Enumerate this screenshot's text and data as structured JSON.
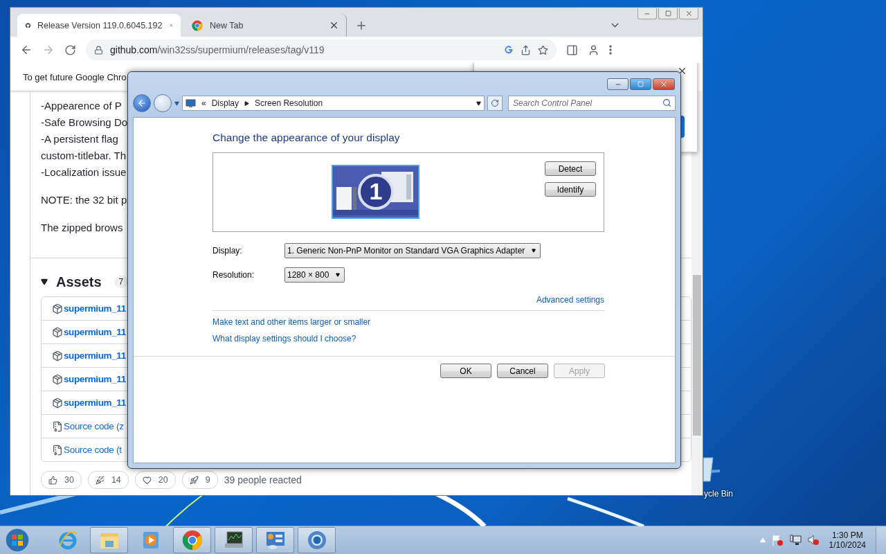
{
  "browser": {
    "tabs": [
      {
        "title": "Release Version 119.0.6045.192",
        "kind": "github",
        "selected": true
      },
      {
        "title": "New Tab",
        "kind": "chrome",
        "selected": false
      }
    ],
    "url_domain": "github.com",
    "url_path": "/win32ss/supermium/releases/tag/v119",
    "banner": "To get future Google Chro",
    "release_notes": [
      "-Appearence of P",
      "-Safe Browsing Do",
      "-A persistent flag",
      "custom-titlebar. Th",
      "-Localization issue"
    ],
    "paragraphs": [
      "NOTE: the 32 bit p",
      "The zipped brows"
    ],
    "assets": {
      "title": "Assets",
      "count": "7",
      "expanded": true,
      "items": [
        {
          "kind": "package",
          "name": "supermium_11"
        },
        {
          "kind": "package",
          "name": "supermium_11"
        },
        {
          "kind": "package",
          "name": "supermium_11"
        },
        {
          "kind": "package",
          "name": "supermium_11"
        },
        {
          "kind": "package",
          "name": "supermium_11"
        },
        {
          "kind": "source",
          "name": "Source code (z"
        },
        {
          "kind": "source",
          "name": "Source code (t"
        }
      ]
    },
    "reactions": [
      {
        "kind": "thumbs",
        "count": "30"
      },
      {
        "kind": "hooray",
        "count": "14"
      },
      {
        "kind": "heart",
        "count": "20"
      },
      {
        "kind": "rocket",
        "count": "9"
      }
    ],
    "reactions_summary": "39 people reacted"
  },
  "dialog": {
    "breadcrumb_overflow": "«",
    "breadcrumb": [
      "Display",
      "Screen Resolution"
    ],
    "search": {
      "placeholder": "Search Control Panel"
    },
    "heading": "Change the appearance of your display",
    "monitor_number": "1",
    "preview_buttons": [
      "Detect",
      "Identify"
    ],
    "fields": [
      {
        "label": "Display:",
        "value": "1. Generic Non-PnP Monitor on Standard VGA Graphics Adapter"
      },
      {
        "label": "Resolution:",
        "value": "1280 × 800"
      }
    ],
    "advanced_link": "Advanced settings",
    "links": [
      "Make text and other items larger or smaller",
      "What display settings should I choose?"
    ],
    "buttons": [
      {
        "label": "OK",
        "disabled": false
      },
      {
        "label": "Cancel",
        "disabled": false
      },
      {
        "label": "Apply",
        "disabled": true
      }
    ]
  },
  "desktop": {
    "icon_label": "ycle Bin"
  },
  "taskbar": {
    "apps": [
      {
        "kind": "ie",
        "open": false
      },
      {
        "kind": "explorer",
        "open": true
      },
      {
        "kind": "media",
        "open": false
      },
      {
        "kind": "chrome",
        "open": true
      },
      {
        "kind": "monitor",
        "open": true
      },
      {
        "kind": "control",
        "open": true
      },
      {
        "kind": "chromium",
        "open": true
      }
    ],
    "clock": {
      "time": "1:30 PM",
      "date": "1/10/2024"
    }
  }
}
